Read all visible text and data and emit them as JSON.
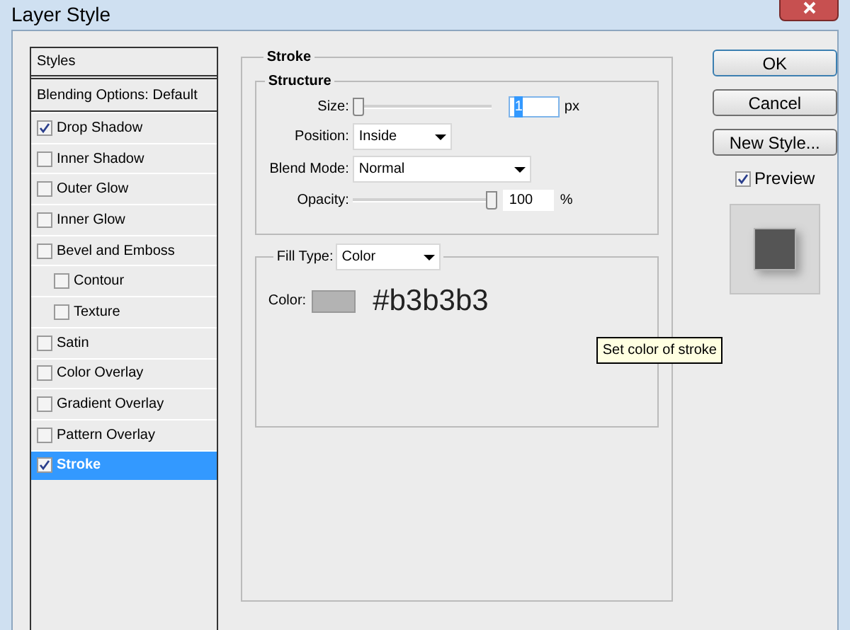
{
  "window": {
    "title": "Layer Style"
  },
  "styles_header": "Styles",
  "blending_options": "Blending Options: Default",
  "styles": [
    {
      "label": "Drop Shadow",
      "checked": true,
      "selected": false
    },
    {
      "label": "Inner Shadow",
      "checked": false,
      "selected": false
    },
    {
      "label": "Outer Glow",
      "checked": false,
      "selected": false
    },
    {
      "label": "Inner Glow",
      "checked": false,
      "selected": false
    },
    {
      "label": "Bevel and Emboss",
      "checked": false,
      "selected": false,
      "children": [
        {
          "label": "Contour",
          "checked": false,
          "selected": false
        },
        {
          "label": "Texture",
          "checked": false,
          "selected": false
        }
      ]
    },
    {
      "label": "Satin",
      "checked": false,
      "selected": false
    },
    {
      "label": "Color Overlay",
      "checked": false,
      "selected": false
    },
    {
      "label": "Gradient Overlay",
      "checked": false,
      "selected": false
    },
    {
      "label": "Pattern Overlay",
      "checked": false,
      "selected": false
    },
    {
      "label": "Stroke",
      "checked": true,
      "selected": true
    }
  ],
  "stroke": {
    "title": "Stroke",
    "structure": {
      "title": "Structure",
      "size": {
        "label": "Size:",
        "level": 0,
        "value": "1",
        "unit": "px"
      },
      "position": {
        "label": "Position:",
        "value": "Inside"
      },
      "blend_mode": {
        "label": "Blend Mode:",
        "value": "Normal"
      },
      "opacity": {
        "label": "Opacity:",
        "level": 1,
        "value": "100",
        "unit": "%"
      }
    },
    "fill_type": {
      "label": "Fill Type:",
      "value": "Color"
    },
    "color": {
      "label": "Color:",
      "color": "#b3b3b3",
      "annotation": "#b3b3b3"
    },
    "tooltip": "Set color of stroke"
  },
  "buttons": [
    "OK",
    "Cancel",
    "New Style..."
  ],
  "preview": {
    "label": "Preview",
    "checked": true
  }
}
